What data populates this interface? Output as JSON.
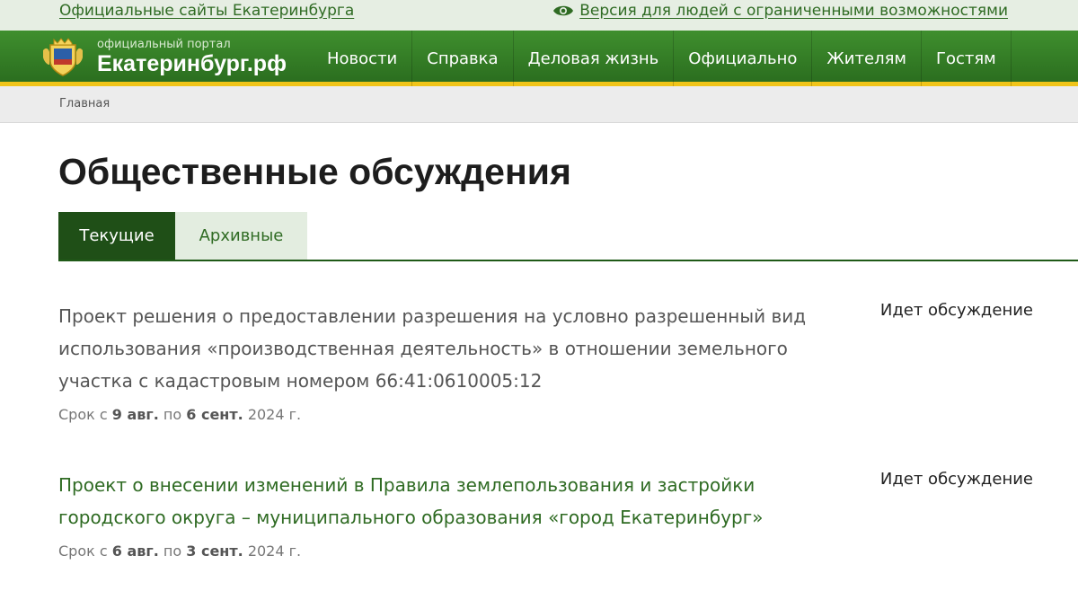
{
  "topbar": {
    "sites_link": "Официальные сайты Екатеринбурга",
    "a11y_link": "Версия для людей с ограниченными возможностями"
  },
  "header": {
    "logo_small": "официальный портал",
    "logo_big": "Екатеринбург.рф",
    "nav": [
      "Новости",
      "Справка",
      "Деловая жизнь",
      "Официально",
      "Жителям",
      "Гостям"
    ]
  },
  "breadcrumb": {
    "home": "Главная"
  },
  "page": {
    "title": "Общественные обсуждения",
    "tabs": {
      "current": "Текущие",
      "archive": "Архивные"
    }
  },
  "items": [
    {
      "title": "Проект решения о предоставлении разрешения на условно разрешенный вид использования «производственная деятельность» в отношении земельного участка с кадастровым номером 66:41:0610005:12",
      "status": "Идет обсуждение",
      "dates": {
        "prefix": "Срок с",
        "start": "9 авг.",
        "mid": "по",
        "end": "6 сент.",
        "year": "2024 г."
      }
    },
    {
      "title": "Проект о внесении изменений в Правила землепользования и застройки городского округа – муниципального образования «город Екатеринбург»",
      "status": "Идет обсуждение",
      "dates": {
        "prefix": "Срок с",
        "start": "6 авг.",
        "mid": "по",
        "end": "3 сент.",
        "year": "2024 г."
      }
    }
  ],
  "colors": {
    "brand_green": "#2b6e1f",
    "accent_yellow": "#f0c419",
    "link_green": "#2f6b23"
  }
}
